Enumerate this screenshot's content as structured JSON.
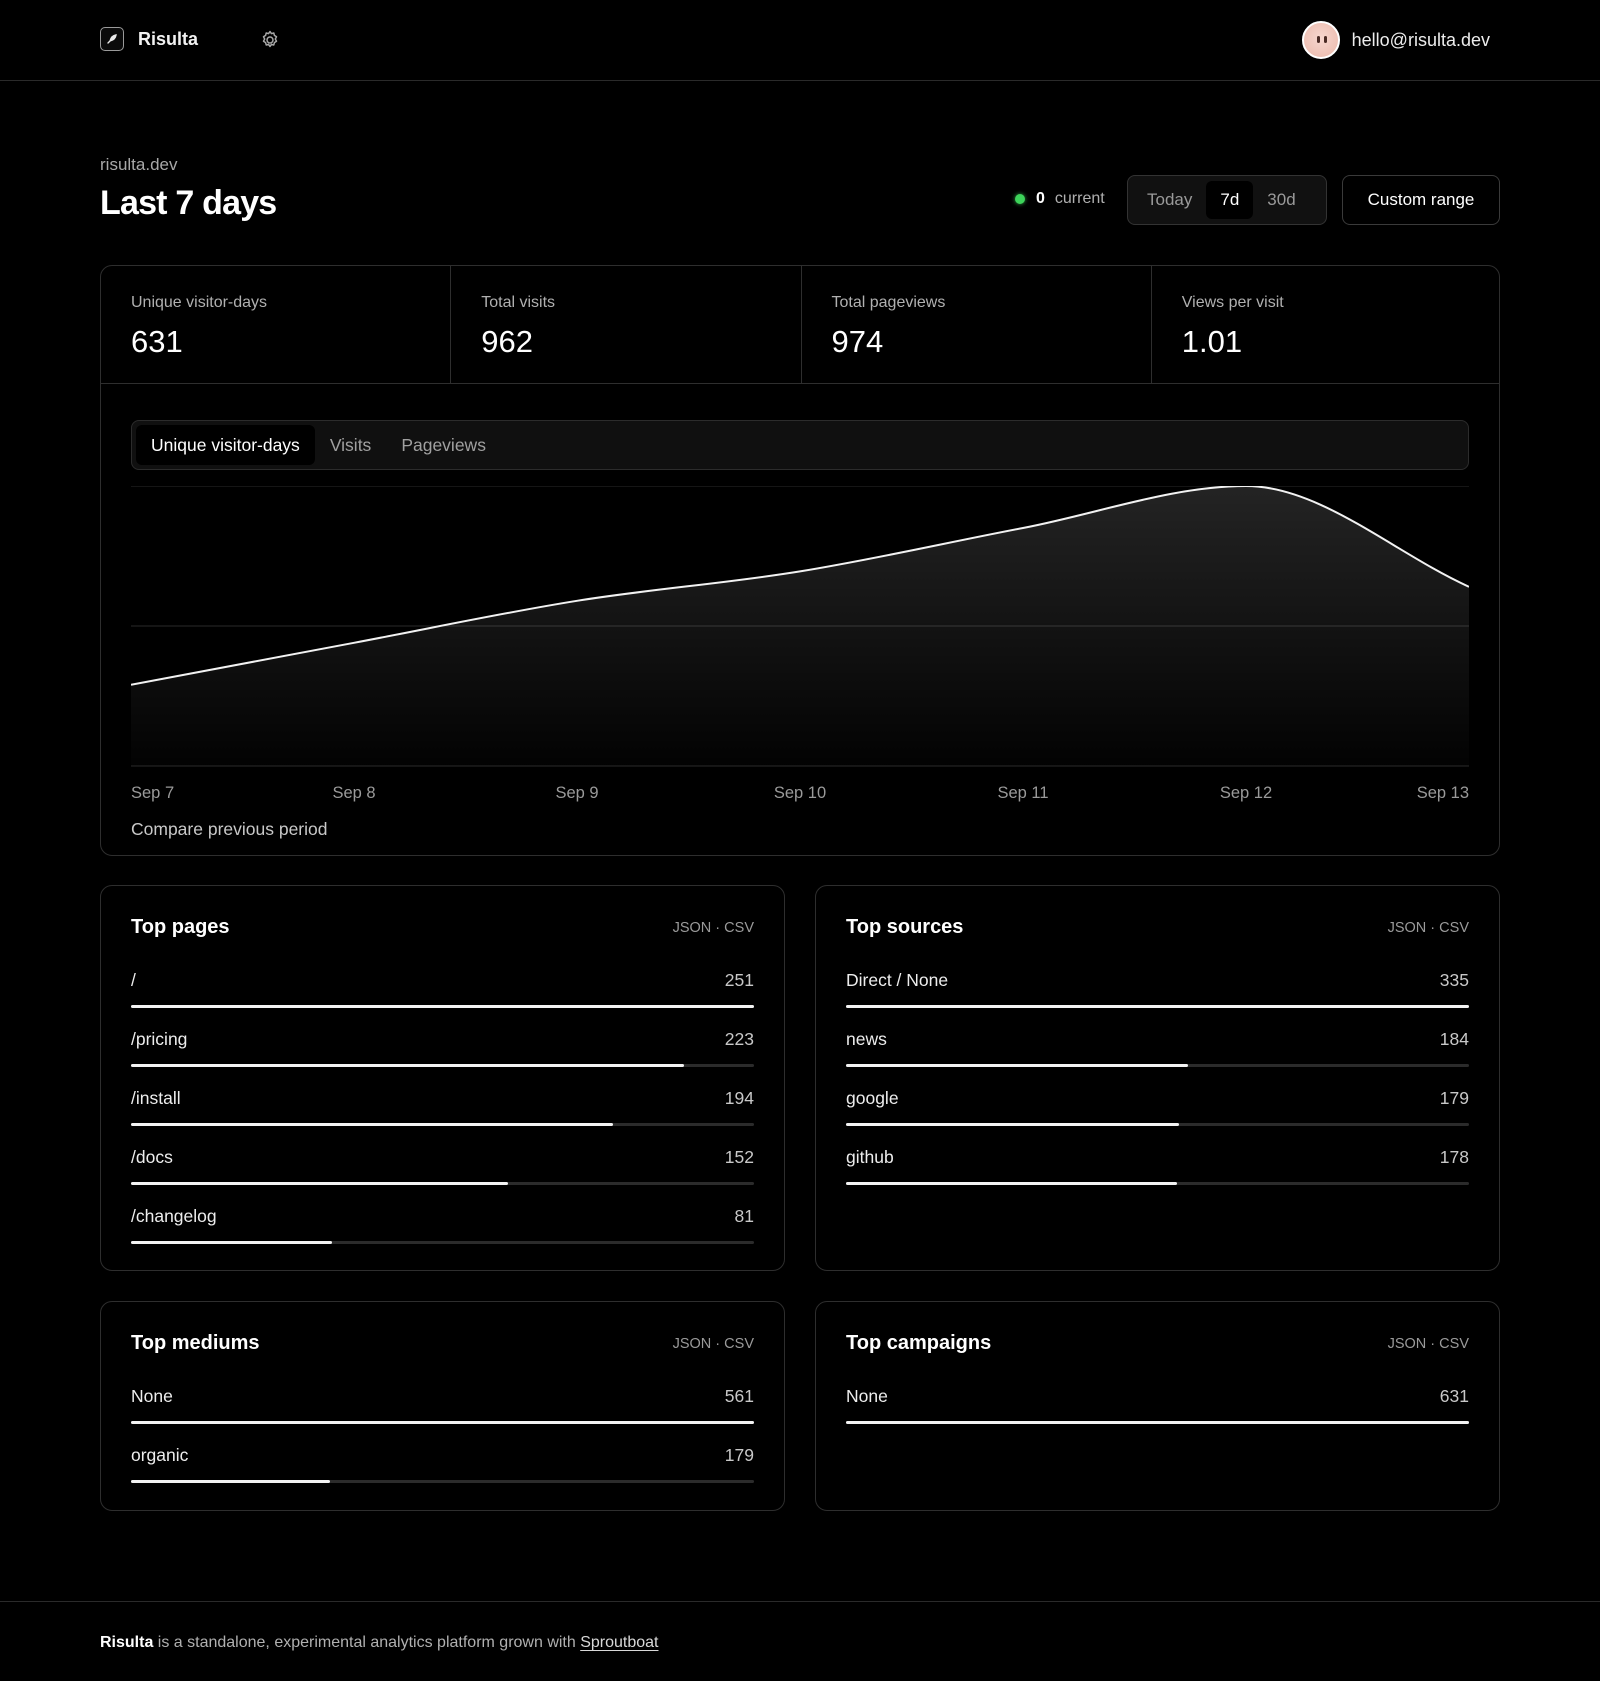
{
  "header": {
    "brand": "Risulta",
    "user_email": "hello@risulta.dev",
    "icons": [
      "feather-logo-icon",
      "gear-icon",
      "avatar"
    ]
  },
  "page": {
    "domain": "risulta.dev",
    "title": "Last 7 days"
  },
  "live": {
    "count": "0",
    "label": "current",
    "dot_color": "#3dd35a"
  },
  "range": {
    "options": [
      {
        "label": "Today",
        "active": false
      },
      {
        "label": "7d",
        "active": true
      },
      {
        "label": "30d",
        "active": false
      }
    ],
    "custom_label": "Custom range"
  },
  "stats": [
    {
      "label": "Unique visitor-days",
      "value": "631"
    },
    {
      "label": "Total visits",
      "value": "962"
    },
    {
      "label": "Total pageviews",
      "value": "974"
    },
    {
      "label": "Views per visit",
      "value": "1.01"
    }
  ],
  "metric_tabs": [
    {
      "label": "Unique visitor-days",
      "active": true
    },
    {
      "label": "Visits",
      "active": false
    },
    {
      "label": "Pageviews",
      "active": false
    }
  ],
  "chart_data": {
    "type": "area",
    "categories": [
      "Sep 7",
      "Sep 8",
      "Sep 9",
      "Sep 10",
      "Sep 11",
      "Sep 12",
      "Sep 13"
    ],
    "values": [
      58,
      88,
      118,
      139,
      170,
      200,
      128
    ],
    "ylim": [
      0,
      200
    ],
    "grid": true,
    "line_color": "#f2f2f2"
  },
  "compare_label": "Compare previous period",
  "panels": [
    {
      "title": "Top pages",
      "export": [
        "JSON",
        "CSV"
      ],
      "rows": [
        {
          "label": "/",
          "count": 251
        },
        {
          "label": "/pricing",
          "count": 223
        },
        {
          "label": "/install",
          "count": 194
        },
        {
          "label": "/docs",
          "count": 152
        },
        {
          "label": "/changelog",
          "count": 81
        }
      ]
    },
    {
      "title": "Top sources",
      "export": [
        "JSON",
        "CSV"
      ],
      "rows": [
        {
          "label": "Direct / None",
          "count": 335
        },
        {
          "label": "news",
          "count": 184
        },
        {
          "label": "google",
          "count": 179
        },
        {
          "label": "github",
          "count": 178
        }
      ]
    },
    {
      "title": "Top mediums",
      "export": [
        "JSON",
        "CSV"
      ],
      "rows": [
        {
          "label": "None",
          "count": 561
        },
        {
          "label": "organic",
          "count": 179
        }
      ]
    },
    {
      "title": "Top campaigns",
      "export": [
        "JSON",
        "CSV"
      ],
      "rows": [
        {
          "label": "None",
          "count": 631
        }
      ]
    }
  ],
  "footer": {
    "brand": "Risulta",
    "text": " is a standalone, experimental analytics platform grown with ",
    "link": "Sproutboat"
  }
}
